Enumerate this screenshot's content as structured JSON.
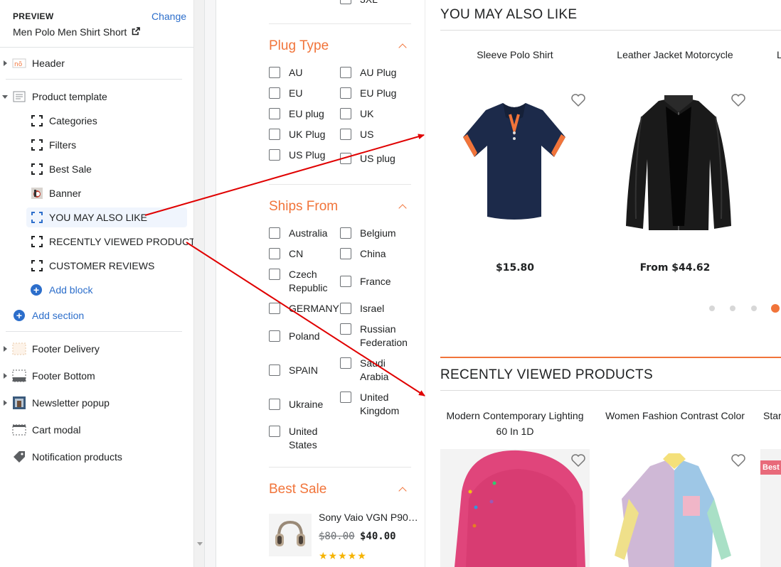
{
  "editor": {
    "preview_label": "PREVIEW",
    "change_link": "Change",
    "product_name": "Men Polo Men Shirt Short",
    "sections": [
      {
        "label": "Header",
        "icon": "header-icon"
      },
      {
        "label": "Product template",
        "icon": "template-icon",
        "expanded": true
      },
      {
        "label": "Footer Delivery",
        "icon": "footer-delivery-icon"
      },
      {
        "label": "Footer Bottom",
        "icon": "footer-bottom-icon"
      },
      {
        "label": "Newsletter popup",
        "icon": "newsletter-icon"
      },
      {
        "label": "Cart modal",
        "icon": "cart-modal-icon"
      },
      {
        "label": "Notification products",
        "icon": "tag-icon"
      }
    ],
    "blocks": [
      {
        "label": "Categories"
      },
      {
        "label": "Filters"
      },
      {
        "label": "Best Sale"
      },
      {
        "label": "Banner"
      },
      {
        "label": "YOU MAY ALSO LIKE",
        "active": true
      },
      {
        "label": "RECENTLY VIEWED PRODUCTS"
      },
      {
        "label": "CUSTOMER REVIEWS"
      }
    ],
    "add_block": "Add block",
    "add_section": "Add section"
  },
  "filters": {
    "top_partial_label": "3XL",
    "plug_type": {
      "title": "Plug Type",
      "left": [
        "AU",
        "EU",
        "EU plug",
        "UK Plug",
        "US Plug"
      ],
      "right": [
        "AU Plug",
        "EU Plug",
        "UK",
        "US",
        "US plug"
      ]
    },
    "ships_from": {
      "title": "Ships From",
      "left": [
        "Australia",
        "CN",
        "Czech Republic",
        "GERMANY",
        "Poland",
        "SPAIN",
        "Ukraine",
        "United States"
      ],
      "right": [
        "Belgium",
        "China",
        "France",
        "Israel",
        "Russian Federation",
        "Saudi Arabia",
        "United Kingdom"
      ]
    },
    "best_sale": {
      "title": "Best Sale",
      "item_name": "Sony Vaio VGN P90…",
      "old_price": "$80.00",
      "new_price": "$40.00",
      "stars": "★★★★★"
    }
  },
  "you_may_also_like": {
    "heading": "YOU MAY ALSO LIKE",
    "products": [
      {
        "title": "Sleeve Polo Shirt",
        "price": "$15.80"
      },
      {
        "title": "Leather Jacket Motorcycle",
        "price": "From $44.62"
      }
    ],
    "slides": 4,
    "active_slide": 4
  },
  "recently_viewed": {
    "heading": "RECENTLY VIEWED PRODUCTS",
    "products": [
      {
        "title": "Modern Contemporary Lighting 60 In 1D"
      },
      {
        "title": "Women Fashion Contrast Color"
      },
      {
        "title": "Star"
      }
    ],
    "badge": "Best"
  },
  "colors": {
    "accent": "#f1743a",
    "link": "#2c6ecb",
    "annotation_arrow": "#e00000"
  }
}
